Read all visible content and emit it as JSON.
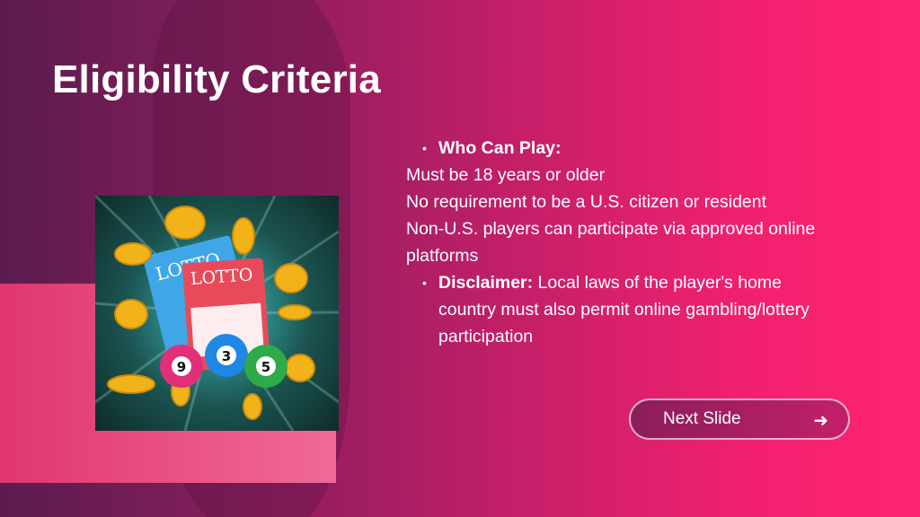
{
  "slide": {
    "title": "Eligibility Criteria",
    "who_heading": "Who Can Play:",
    "who_lines": [
      "Must be 18 years or older",
      "No requirement to be a U.S. citizen or resident",
      "Non-U.S. players can participate via approved online",
      "platforms"
    ],
    "disclaimer_heading": "Disclaimer:",
    "disclaimer_text": " Local laws of the player's home country must also permit online gambling/lottery participation",
    "next_label": "Next Slide",
    "next_icon": "right-arrow-icon"
  },
  "image": {
    "ticket_text": "LOTTO",
    "ball_numbers": [
      "9",
      "3",
      "5"
    ],
    "colors": {
      "ball_pink": "#e0307a",
      "ball_blue": "#1e88e5",
      "ball_green": "#2eaa4a",
      "coin": "#f2b21a"
    }
  }
}
